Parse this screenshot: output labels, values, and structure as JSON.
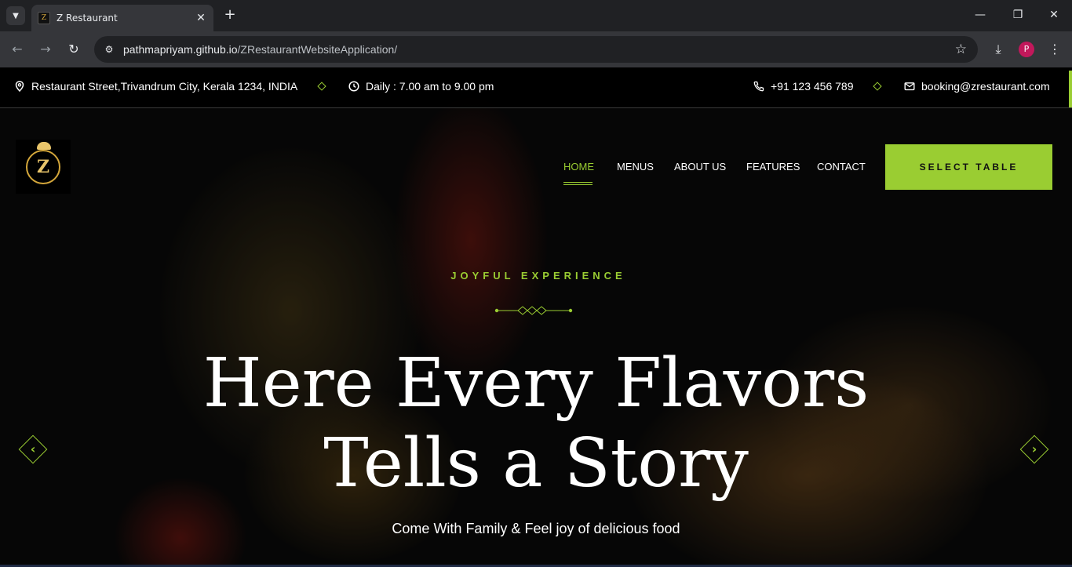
{
  "browser": {
    "tab_title": "Z Restaurant",
    "tab_favicon": "Z",
    "new_tab": "+",
    "url_host": "pathmapriyam.github.io",
    "url_path": "/ZRestaurantWebsiteApplication/",
    "profile_initial": "P"
  },
  "infobar": {
    "address": "Restaurant Street,Trivandrum City, Kerala 1234, INDIA",
    "hours": "Daily : 7.00 am to 9.00 pm",
    "phone": "+91 123 456 789",
    "email": "booking@zrestaurant.com"
  },
  "logo": {
    "letter": "Z"
  },
  "nav": {
    "items": [
      "HOME",
      "MENUS",
      "ABOUT US",
      "FEATURES",
      "CONTACT"
    ],
    "active": "HOME",
    "cta": "SELECT TABLE"
  },
  "hero": {
    "eyebrow": "JOYFUL EXPERIENCE",
    "headline_line1": "Here Every Flavors",
    "headline_line2": "Tells a Story",
    "subline": "Come With Family & Feel joy of delicious food"
  },
  "colors": {
    "accent": "#9acd32",
    "gold": "#d4a73b",
    "background": "#0a0a0a"
  },
  "icons": [
    "location-icon",
    "clock-icon",
    "phone-icon",
    "mail-icon",
    "chevron-left-icon",
    "chevron-right-icon"
  ]
}
